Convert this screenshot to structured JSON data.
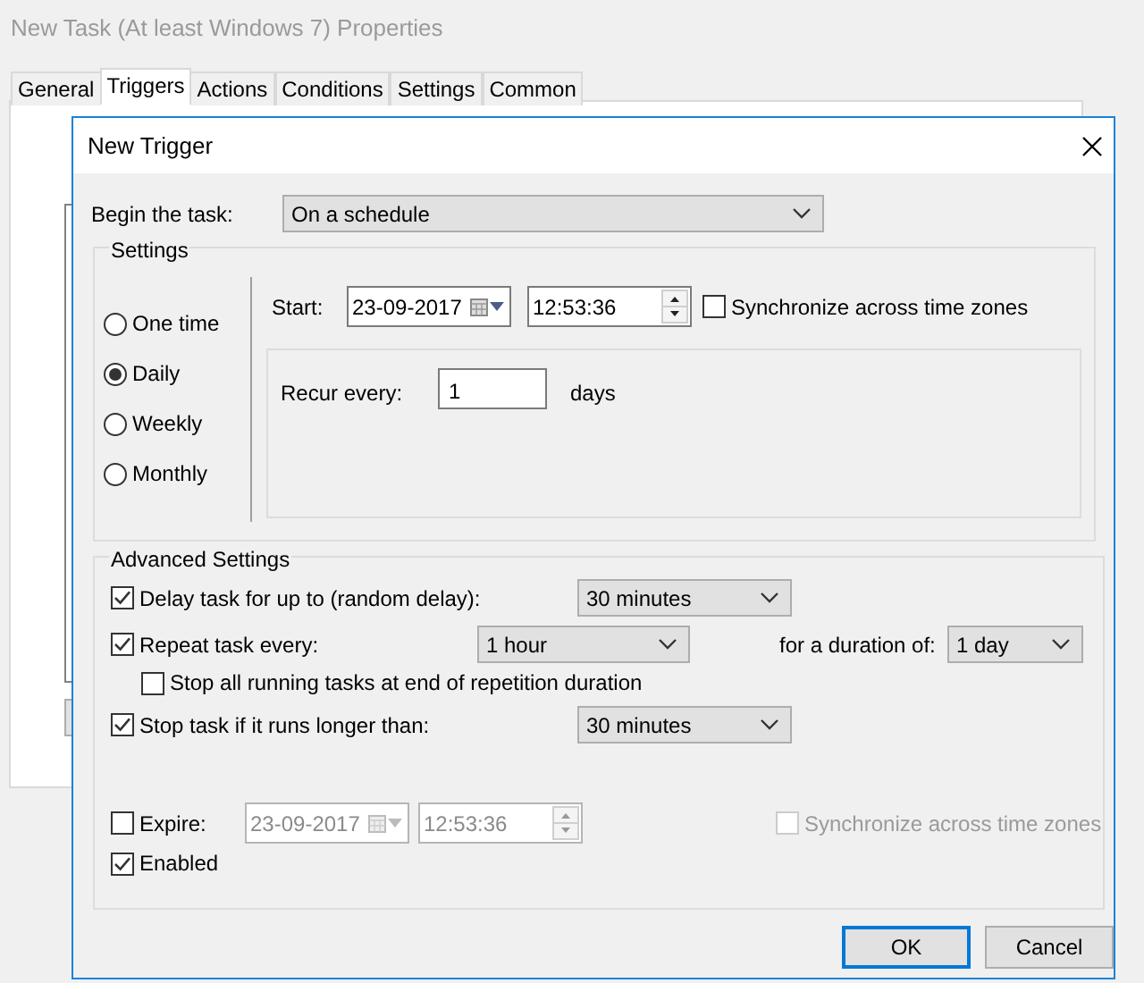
{
  "window": {
    "title": "New Task (At least Windows 7) Properties"
  },
  "tabs": [
    {
      "label": "General",
      "selected": false
    },
    {
      "label": "Triggers",
      "selected": true
    },
    {
      "label": "Actions",
      "selected": false
    },
    {
      "label": "Conditions",
      "selected": false
    },
    {
      "label": "Settings",
      "selected": false
    },
    {
      "label": "Common",
      "selected": false
    }
  ],
  "dialog": {
    "title": "New Trigger",
    "begin_task": {
      "label": "Begin the task:",
      "value": "On a schedule"
    },
    "settings": {
      "title": "Settings",
      "schedule_options": [
        {
          "label": "One time",
          "selected": false
        },
        {
          "label": "Daily",
          "selected": true
        },
        {
          "label": "Weekly",
          "selected": false
        },
        {
          "label": "Monthly",
          "selected": false
        }
      ],
      "start": {
        "label": "Start:",
        "date": "23-09-2017",
        "time": "12:53:36"
      },
      "sync": {
        "label": "Synchronize across time zones",
        "checked": false
      },
      "recur": {
        "label": "Recur every:",
        "value": "1",
        "unit": "days"
      }
    },
    "advanced": {
      "title": "Advanced Settings",
      "delay": {
        "label": "Delay task for up to (random delay):",
        "checked": true,
        "value": "30 minutes"
      },
      "repeat": {
        "label": "Repeat task every:",
        "checked": true,
        "value": "1 hour",
        "duration_label": "for a duration of:",
        "duration": "1 day"
      },
      "stop_all": {
        "label": "Stop all running tasks at end of repetition duration",
        "checked": false
      },
      "stop_longer": {
        "label": "Stop task if it runs longer than:",
        "checked": true,
        "value": "30 minutes"
      },
      "expire": {
        "label": "Expire:",
        "checked": false,
        "date": "23-09-2017",
        "time": "12:53:36"
      },
      "expire_sync": {
        "label": "Synchronize across time zones",
        "checked": false,
        "disabled": true
      },
      "enabled": {
        "label": "Enabled",
        "checked": true
      }
    },
    "buttons": [
      {
        "label": "OK",
        "default": true
      },
      {
        "label": "Cancel",
        "default": false
      }
    ]
  }
}
